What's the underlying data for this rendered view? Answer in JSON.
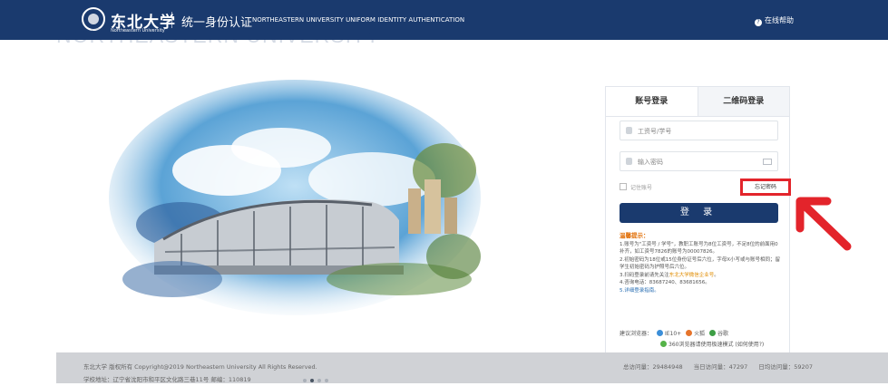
{
  "header": {
    "logo_cn": "东北大学",
    "logo_en": "Northeastern University",
    "title": "统一身份认证",
    "title_en": "NORTHEASTERN UNIVERSITY UNIFORM IDENTITY AUTHENTICATION",
    "help": "在线帮助",
    "watermark": "NORTHEASTERN UNIVERSITY"
  },
  "login": {
    "tabs": [
      {
        "label": "账号登录",
        "active": true
      },
      {
        "label": "二维码登录",
        "active": false
      }
    ],
    "username_placeholder": "工资号/学号",
    "password_placeholder": "输入密码",
    "remember_label": "记住账号",
    "forgot_label": "忘记密码",
    "submit_label": "登 录",
    "tips": {
      "title": "温馨提示：",
      "lines": [
        "1.账号为\"工资号 / 学号\"，教职工账号为8位工资号，不足8位的前面用0补齐，如工资号7826的账号为00007826。",
        "2.初始密码为18位或15位身份证号后六位，字母X小写或与账号相同；留学生初始密码为护照号后六位。",
        "3.扫码登录前请先关注",
        "4.咨询电话：83687240、83681656。",
        "5.详细登录指南。"
      ],
      "wechat_link": "东北大学微信企业号",
      "wechat_suffix": "。"
    },
    "browsers": {
      "label": "建议浏览器：",
      "ie": "IE10+",
      "firefox": "火狐",
      "chrome": "谷歌",
      "note_360": "360浏览器请使用极速模式 (如何使用?)"
    }
  },
  "footer": {
    "copyright": "东北大学 版权所有 Copyright@2019 Northeastern University All Rights Reserved.",
    "address": "学校地址：辽宁省沈阳市和平区文化路三巷11号 邮编：110819",
    "stats": {
      "total": "总访问量：29484948",
      "today": "当日访问量：47297",
      "daily_avg": "日均访问量：59207"
    }
  },
  "colors": {
    "brand": "#1a3a6e",
    "highlight": "#e3242b"
  }
}
